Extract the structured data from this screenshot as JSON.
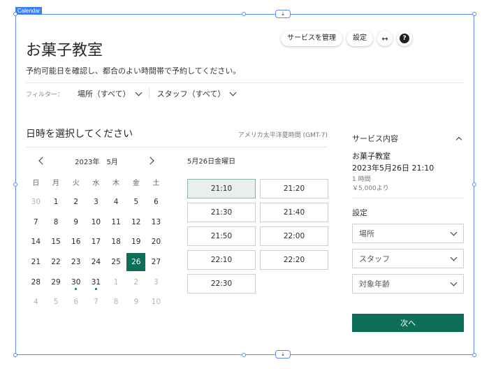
{
  "editor": {
    "frame_label": "Calendar",
    "download_glyph": "⤓"
  },
  "toolbar": {
    "manage_services": "サービスを管理",
    "settings": "設定",
    "stretch_icon": "↔",
    "help_glyph": "?"
  },
  "header": {
    "title": "お菓子教室",
    "subtitle": "予約可能日を確認し、都合のよい時間帯で予約してください。"
  },
  "filters": {
    "label": "フィルター：",
    "location": "場所（すべて）",
    "staff": "スタッフ（すべて）"
  },
  "calendar": {
    "section_title": "日時を選択してください",
    "timezone": "アメリカ太平洋夏時間 (GMT-7)",
    "month_label": "2023年　5月",
    "weekdays": [
      "日",
      "月",
      "火",
      "水",
      "木",
      "金",
      "土"
    ],
    "days": [
      [
        "30",
        "1",
        "2",
        "3",
        "4",
        "5",
        "6"
      ],
      [
        "7",
        "8",
        "9",
        "10",
        "11",
        "12",
        "13"
      ],
      [
        "14",
        "15",
        "16",
        "17",
        "18",
        "19",
        "20"
      ],
      [
        "21",
        "22",
        "23",
        "24",
        "25",
        "26",
        "27"
      ],
      [
        "28",
        "29",
        "30",
        "31",
        "1",
        "2",
        "3"
      ],
      [
        "4",
        "5",
        "6",
        "7",
        "8",
        "9",
        "10"
      ]
    ],
    "selected_day": "26",
    "days_with_dots": [
      "30",
      "31"
    ]
  },
  "timeslots": {
    "date_heading": "5月26日金曜日",
    "slots": [
      "21:10",
      "21:20",
      "21:30",
      "21:40",
      "21:50",
      "22:00",
      "22:10",
      "22:20",
      "22:30"
    ],
    "selected": "21:10"
  },
  "sidebar": {
    "section_title": "サービス内容",
    "service_name": "お菓子教室",
    "datetime": "2023年5月26日 21:10",
    "duration": "1 時間",
    "price": "￥5,000より",
    "settings_label": "設定",
    "location_placeholder": "場所",
    "staff_placeholder": "スタッフ",
    "age_placeholder": "対象年齢",
    "next_button": "次へ"
  },
  "colors": {
    "accent": "#0d6e57",
    "selection_frame": "#5b8def"
  }
}
